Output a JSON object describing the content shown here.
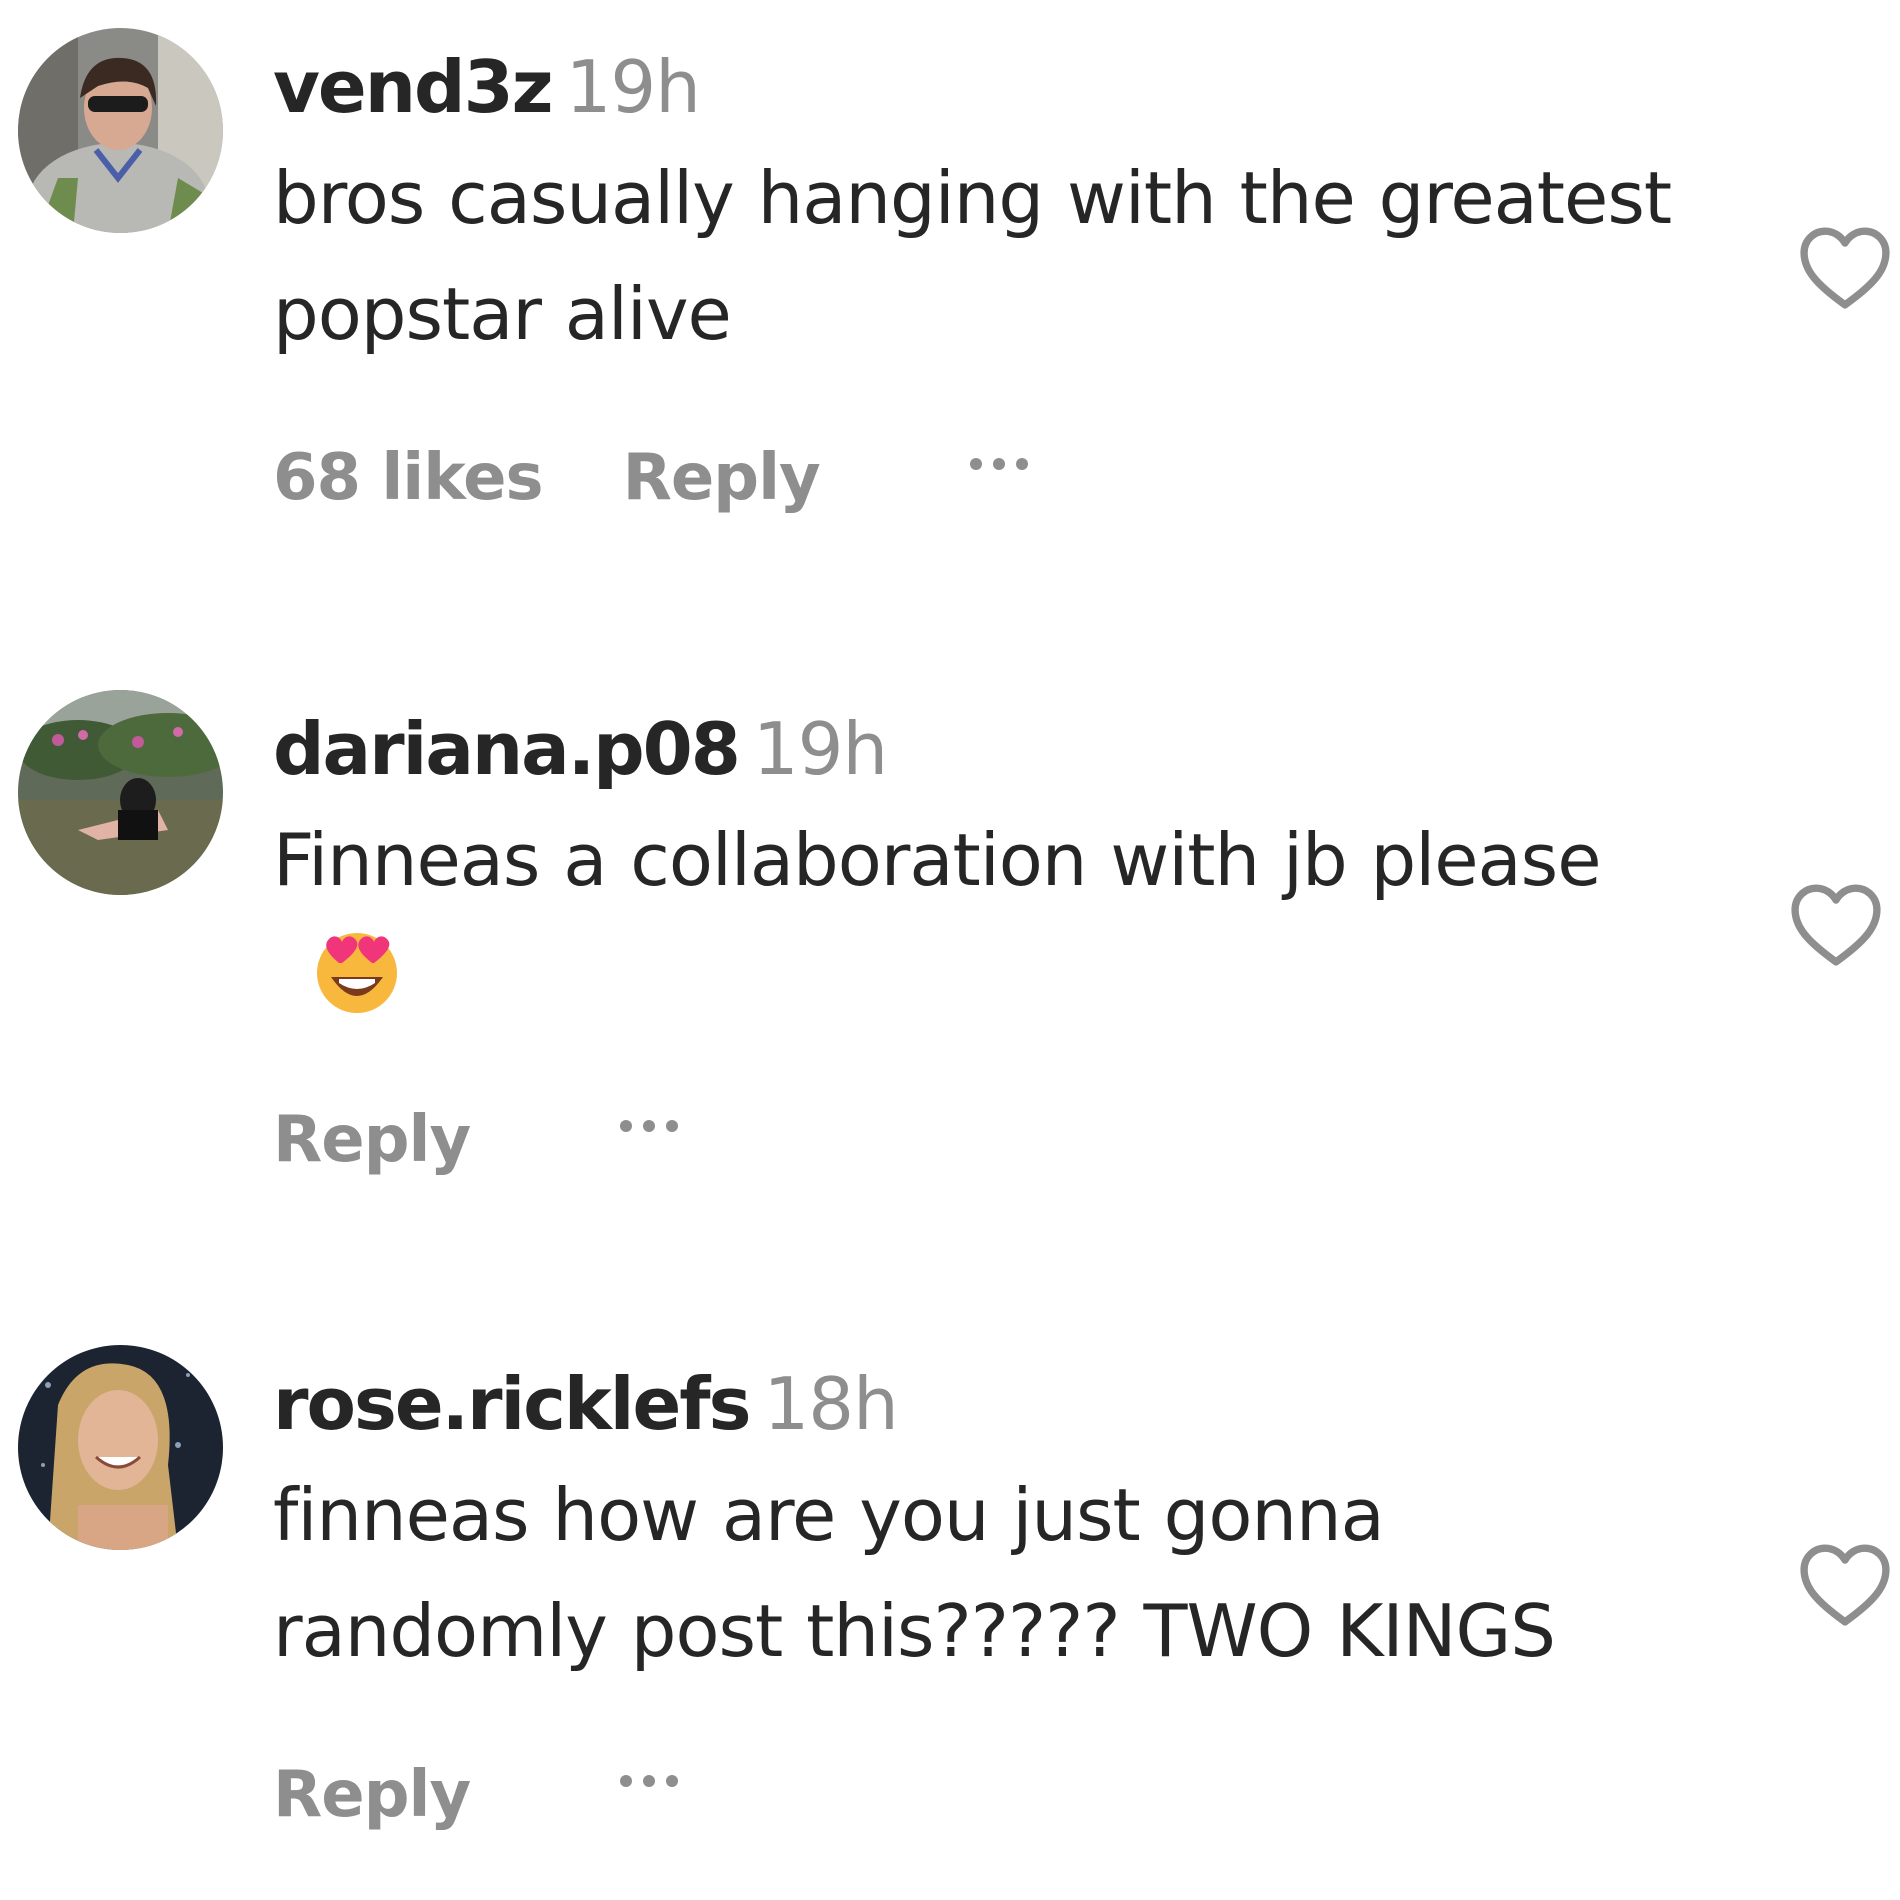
{
  "comments": [
    {
      "username": "vend3z",
      "time": "19h",
      "text": "bros casually hanging with the greatest popstar alive",
      "likes": "68 likes",
      "reply_label": "Reply",
      "has_emoji": false
    },
    {
      "username": "dariana.p08",
      "time": "19h",
      "text": "Finneas a collaboration with jb please",
      "emoji": "heart-eyes-emoji",
      "reply_label": "Reply"
    },
    {
      "username": "rose.ricklefs",
      "time": "18h",
      "text": "finneas how are you just gonna randomly post this????? TWO KINGS",
      "reply_label": "Reply"
    }
  ],
  "icons": {
    "like": "heart-outline-icon",
    "more": "more-options-icon"
  },
  "colors": {
    "text": "#262626",
    "secondary": "#8e8e8e",
    "emoji_face": "#f7b83d",
    "emoji_hearts": "#f0357a"
  }
}
